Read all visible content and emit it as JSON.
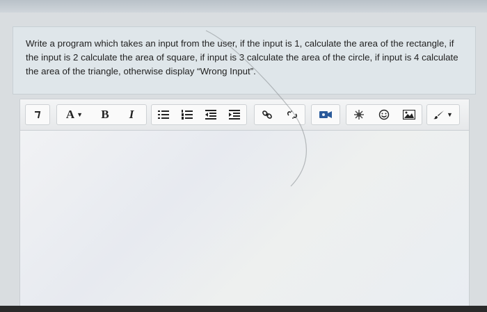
{
  "question": {
    "text": "Write a program which takes an input from the user, if the input is 1, calculate the area of the rectangle, if the input is 2 calculate the area of square, if input is 3 calculate the area of the circle, if input is 4 calculate the area of the triangle, otherwise display “Wrong Input”."
  },
  "toolbar": {
    "font_size_label": "A",
    "bold_label": "B",
    "italic_label": "I",
    "icons": [
      "paragraph-icon",
      "font-size-icon",
      "bold-icon",
      "italic-icon",
      "bullet-list-icon",
      "numbered-list-icon",
      "outdent-icon",
      "indent-icon",
      "link-icon",
      "unlink-icon",
      "media-icon",
      "special-char-icon",
      "emoji-icon",
      "image-icon",
      "brush-icon"
    ]
  },
  "colors": {
    "panel_bg": "#dfe6ea",
    "toolbar_bg": "#f4f5f6",
    "text": "#222222",
    "media_icon": "#2a5a9a"
  }
}
